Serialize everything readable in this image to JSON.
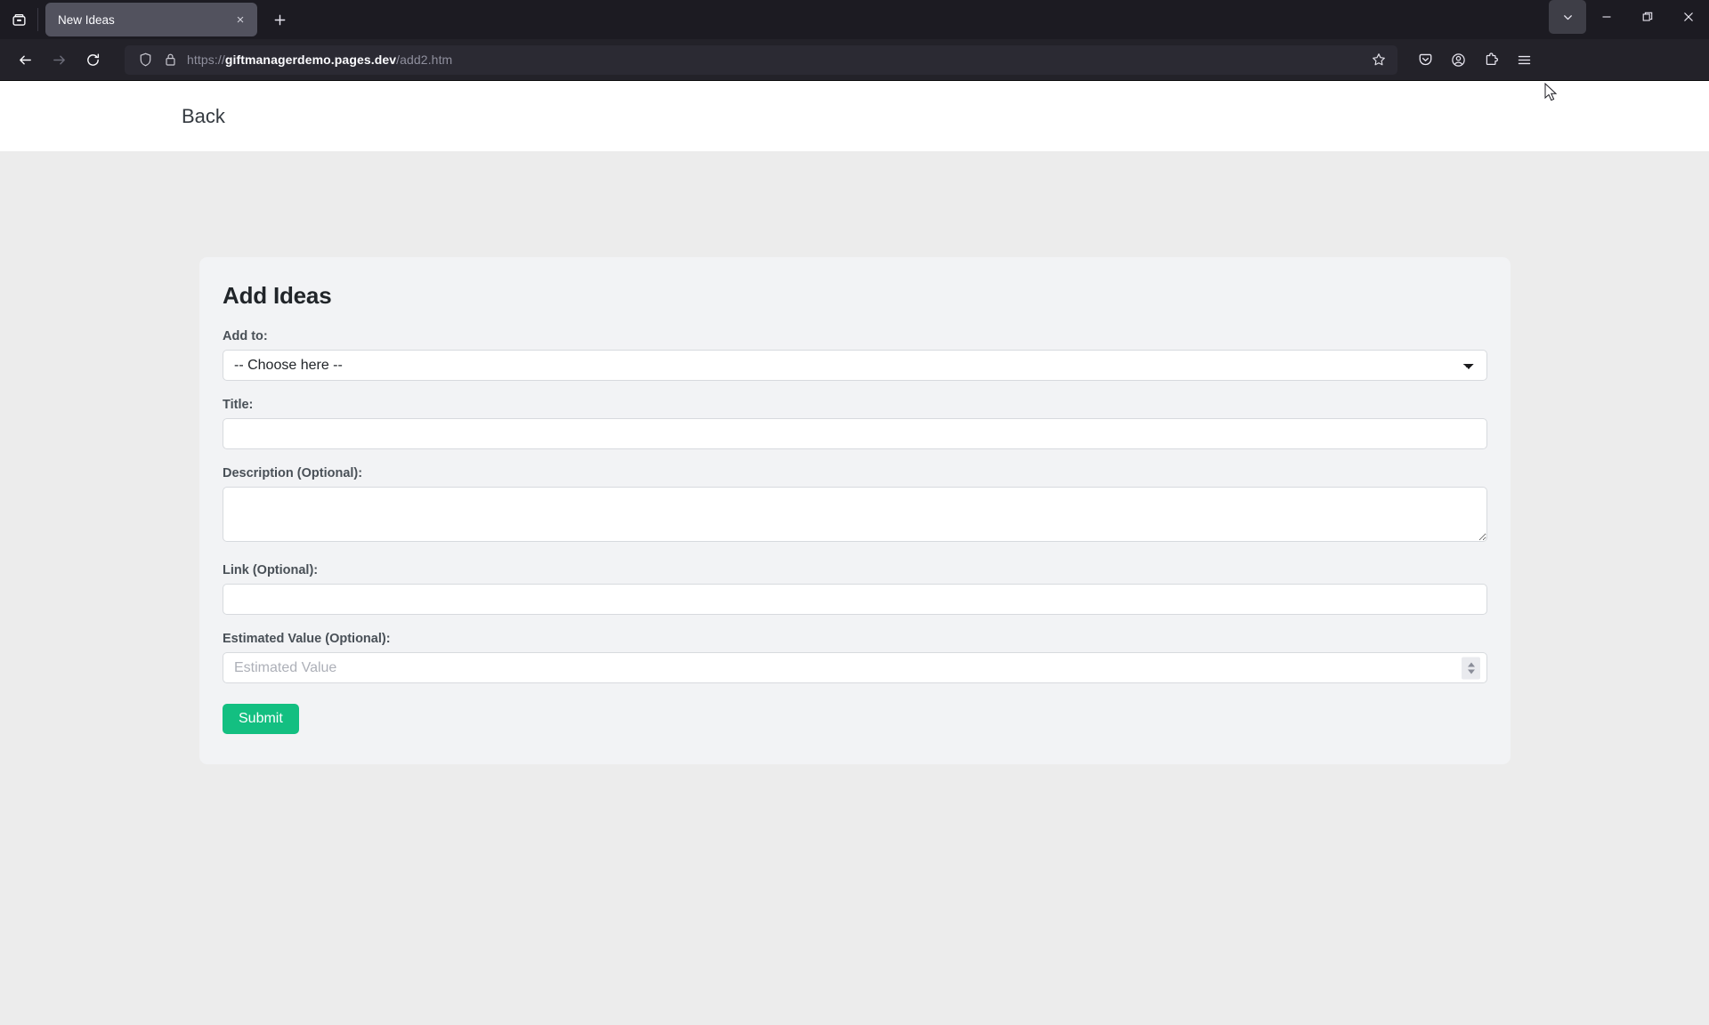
{
  "browser": {
    "tab": {
      "title": "New Ideas",
      "close_label": "×",
      "tablist_icon": "tab-list-icon",
      "newtab_label": "+"
    },
    "nav": {
      "back_icon": "back-arrow-icon",
      "forward_icon": "forward-arrow-icon",
      "reload_icon": "reload-icon"
    },
    "urlbar": {
      "shield_icon": "shield-icon",
      "lock_icon": "lock-icon",
      "url_scheme": "https://",
      "url_host": "giftmanagerdemo.pages.dev",
      "url_path": "/add2.htm",
      "full_url": "https://giftmanagerdemo.pages.dev/add2.htm",
      "bookmark_icon": "bookmark-star-icon"
    },
    "toolbar_right": {
      "pocket_icon": "pocket-save-icon",
      "account_icon": "account-circle-icon",
      "extensions_icon": "extensions-puzzle-icon",
      "menu_icon": "hamburger-menu-icon"
    },
    "window_controls": {
      "chevron_label": "chevron-down-icon",
      "minimize_label": "─",
      "maximize_label": "❐",
      "close_label": "✕"
    }
  },
  "page": {
    "header": {
      "back_label": "Back"
    },
    "card": {
      "title": "Add Ideas",
      "fields": {
        "add_to": {
          "label": "Add to:",
          "selected": "-- Choose here --",
          "options": [
            "-- Choose here --"
          ]
        },
        "title": {
          "label": "Title:",
          "value": "",
          "placeholder": ""
        },
        "description": {
          "label": "Description (Optional):",
          "value": "",
          "placeholder": ""
        },
        "link": {
          "label": "Link (Optional):",
          "value": "",
          "placeholder": ""
        },
        "estimated_value": {
          "label": "Estimated Value (Optional):",
          "value": "",
          "placeholder": "Estimated Value"
        }
      },
      "submit_label": "Submit"
    }
  },
  "colors": {
    "accent_green": "#13bf81",
    "page_bg": "#ececec",
    "card_bg": "#f2f3f5",
    "header_bg": "#ffffff",
    "chrome_bg": "#1c1b22",
    "navbar_bg": "#232229",
    "tab_active_bg": "#52525e"
  }
}
